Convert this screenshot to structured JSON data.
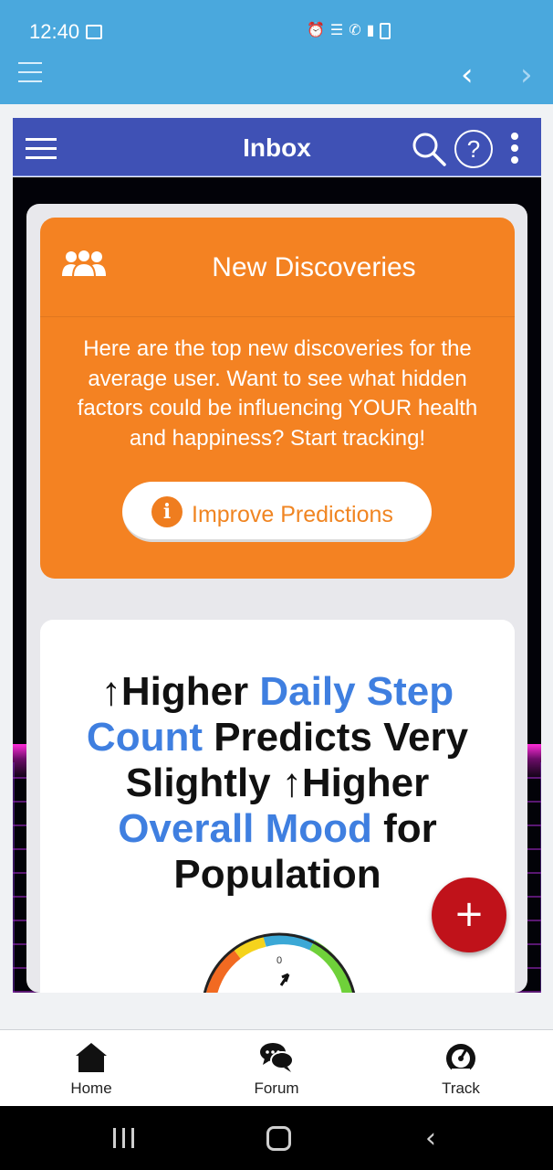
{
  "status": {
    "time": "12:40"
  },
  "header": {
    "title": "Inbox"
  },
  "discoveries": {
    "title": "New Discoveries",
    "body": "Here are the top new discoveries for the average user. Want to see what hidden factors could be influencing YOUR health and happiness? Start tracking!",
    "button_label": "Improve Predictions"
  },
  "study": {
    "arrow1": "↑",
    "higher1": "Higher ",
    "cause": "Daily Step Count",
    "predicts": " Predicts Very Slightly ",
    "arrow2": "↑",
    "higher2": "Higher ",
    "effect": "Overall Mood",
    "suffix": " for Population",
    "gauge_label": "0"
  },
  "fab": {
    "label": "+"
  },
  "bottom_nav": [
    {
      "label": "Home",
      "icon": "home-icon"
    },
    {
      "label": "Forum",
      "icon": "chat-bubbles-icon"
    },
    {
      "label": "Track",
      "icon": "speedometer-icon"
    }
  ],
  "colors": {
    "status_bar": "#4aa8dd",
    "app_header": "#3f51b5",
    "discovery_card": "#f48222",
    "highlight": "#3f7fe0",
    "fab": "#c0121a"
  }
}
